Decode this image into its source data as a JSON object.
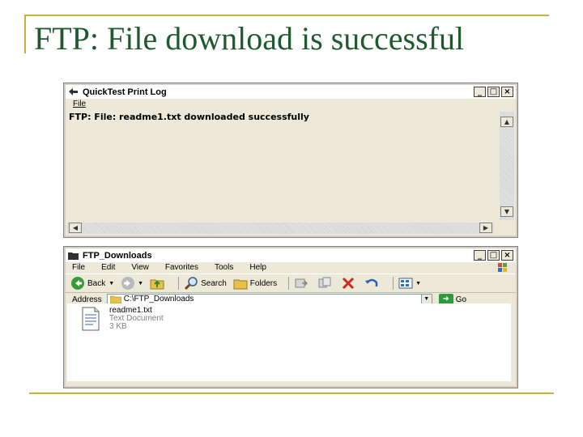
{
  "slide": {
    "title": "FTP: File download is successful"
  },
  "log_window": {
    "title": "QuickTest Print Log",
    "menu": [
      "File"
    ],
    "controls": {
      "minimize": "_",
      "maximize": "□",
      "close": "×"
    },
    "log_line": "FTP: File: readme1.txt downloaded successfully"
  },
  "explorer_window": {
    "title": "FTP_Downloads",
    "controls": {
      "minimize": "_",
      "maximize": "□",
      "close": "×"
    },
    "menu": [
      "File",
      "Edit",
      "View",
      "Favorites",
      "Tools",
      "Help"
    ],
    "toolbar": {
      "back": "Back",
      "search": "Search",
      "folders": "Folders"
    },
    "address_label": "Address",
    "address_value": "C:\\FTP_Downloads",
    "go_label": "Go",
    "file": {
      "name": "readme1.txt",
      "type": "Text Document",
      "size": "3 KB"
    }
  },
  "colors": {
    "frame_gold": "#c9b23c",
    "title_green": "#1e5a2e",
    "window_face": "#ece9d8"
  }
}
